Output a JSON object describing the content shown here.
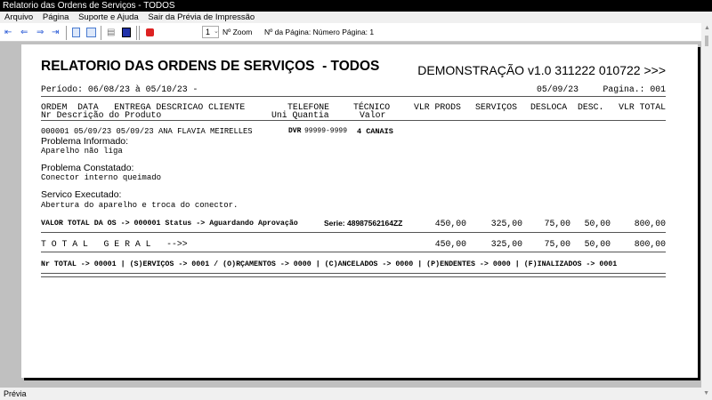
{
  "window": {
    "title": "Relatorio das Ordens de Serviços  - TODOS"
  },
  "menu": [
    "Arquivo",
    "Página",
    "Suporte e Ajuda",
    "Sair da Prévia de Impressão"
  ],
  "toolbar": {
    "zoom_value": "1",
    "zoom_label": "Nº Zoom",
    "page_label": "Nº da Página: Número Página: 1"
  },
  "report": {
    "title": "RELATORIO DAS ORDENS DE SERVIÇOS  - TODOS",
    "demo": "DEMONSTRAÇÃO v1.0 311222 010722 >>>",
    "period": "Período: 06/08/23 à 05/10/23 -",
    "date": "05/09/23",
    "page": "Pagina.: 001",
    "headers1": [
      "ORDEM  DATA   ENTREGA DESCRICAO CLIENTE",
      "TELEFONE",
      "TÉCNICO",
      "VLR PRODS",
      "SERVIÇOS",
      "DESLOCA",
      "DESC.",
      "VLR TOTAL"
    ],
    "headers2": [
      "Nr Descrição do Produto",
      "Uni Quantia",
      "Valor"
    ],
    "row": {
      "text": "000001 05/09/23 05/09/23 ANA FLAVIA MEIRELLES",
      "ddd": "DVR",
      "phone": "99999-9999",
      "tech": "4 CANAIS"
    },
    "problem_informed_label": "Problema Informado:",
    "problem_informed": "Aparelho não liga",
    "problem_found_label": "Problema Constatado:",
    "problem_found": "Conector interno queimado",
    "service_label": "Servico Executado:",
    "service": "Abertura do aparelho e troca do conector.",
    "os_total": {
      "label": "VALOR TOTAL DA OS -> 000001 Status -> Aguardando Aprovação",
      "serie": "Serie: 48987562164ZZ",
      "values": [
        "450,00",
        "325,00",
        "75,00",
        "50,00",
        "800,00"
      ]
    },
    "grand_total": {
      "label": "T O T A L   G E R A L   -->>",
      "values": [
        "450,00",
        "325,00",
        "75,00",
        "50,00",
        "800,00"
      ]
    },
    "summary": "Nr TOTAL -> 00001 | (S)ERVIÇOS -> 0001 / (O)RÇAMENTOS -> 0000 | (C)ANCELADOS -> 0000 | (P)ENDENTES -> 0000 | (F)INALIZADOS -> 0001"
  },
  "status": "Prévia"
}
